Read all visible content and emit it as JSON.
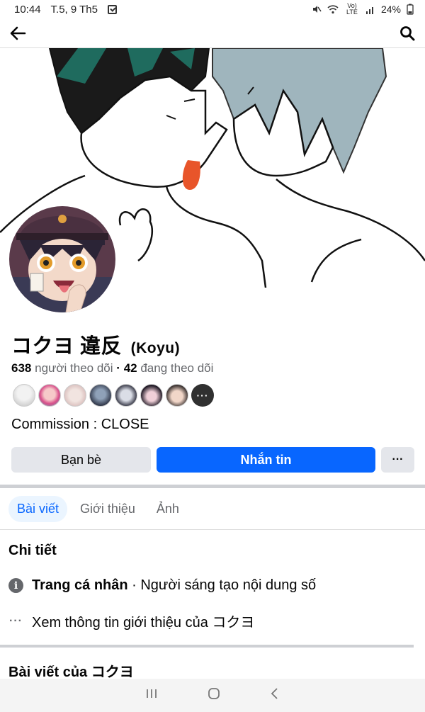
{
  "status_bar": {
    "time": "10:44",
    "date": "T.5, 9 Th5",
    "network": "Vo) LTE",
    "battery": "24%"
  },
  "profile": {
    "name": "コクヨ 違反",
    "alias": "(Koyu)",
    "followers_count": "638",
    "followers_label": "người theo dõi",
    "separator": "·",
    "following_count": "42",
    "following_label": "đang theo dõi",
    "more_friends": "···",
    "bio": "Commission : CLOSE"
  },
  "actions": {
    "friends_label": "Bạn bè",
    "message_label": "Nhắn tin",
    "more_label": "···"
  },
  "tabs": [
    {
      "label": "Bài viết",
      "active": true
    },
    {
      "label": "Giới thiệu",
      "active": false
    },
    {
      "label": "Ảnh",
      "active": false
    }
  ],
  "details": {
    "title": "Chi tiết",
    "type_strong": "Trang cá nhân",
    "type_rest": " · Người sáng tạo nội dung số",
    "see_about": "Xem thông tin giới thiệu của コクヨ",
    "info_icon_glyph": "i",
    "dots_glyph": "···"
  },
  "posts": {
    "title": "Bài viết của コクヨ"
  },
  "colors": {
    "accent": "#0866ff",
    "secondary_button": "#e4e6eb",
    "muted_text": "#65676b",
    "active_tab_bg": "#ebf5ff"
  }
}
